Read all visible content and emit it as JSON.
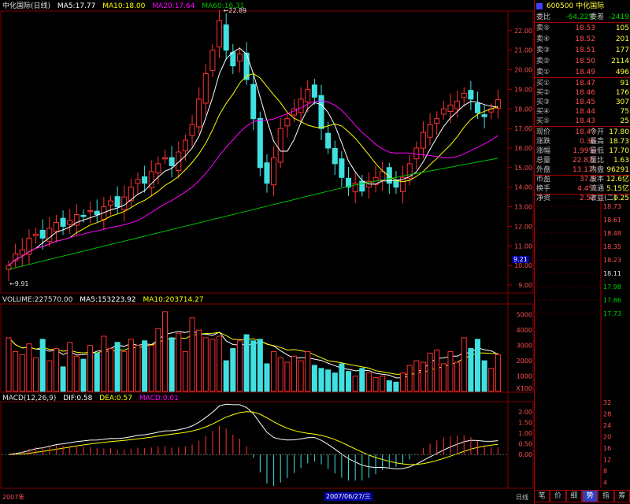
{
  "header": {
    "name": "中化国际(日线)",
    "ma5": "MA5:17.77",
    "ma10": "MA10:18.00",
    "ma20": "MA20:17.64",
    "ma60": "MA60:16.31"
  },
  "volume_header": {
    "label": "VOLUME:227570.00",
    "ma5": "MA5:153223.92",
    "ma10": "MA10:203714.27"
  },
  "macd_header": {
    "label": "MACD(12,26,9)",
    "dif": "DIF:0.58",
    "dea": "DEA:0.57",
    "macd": "MACD:0.01"
  },
  "bottom_axis": {
    "left": "2007年",
    "center": "2007/06/27/三",
    "right": "日线"
  },
  "marker_9": "9.21",
  "colors": {
    "up": "#ff3030",
    "down": "#40e0e0",
    "ma5": "#ffffff",
    "ma10": "#ffff00",
    "ma20": "#ff00ff",
    "ma60": "#00c000",
    "grid": "#800000"
  },
  "chart_data": [
    {
      "type": "candlestick",
      "title": "中化国际(日线)",
      "ylim": [
        9,
        23
      ],
      "yticks": [
        "22.00",
        "21.00",
        "20.00",
        "19.00",
        "18.00",
        "17.00",
        "16.00",
        "15.00",
        "14.00",
        "13.00",
        "12.00",
        "11.00",
        "10.00",
        "9.00"
      ],
      "annotations": [
        {
          "text": "22.89",
          "label": "high"
        },
        {
          "text": "9.91",
          "label": "low"
        }
      ],
      "close_approx": [
        10.0,
        10.6,
        10.8,
        11.4,
        11.6,
        11.4,
        11.9,
        12.2,
        12.0,
        12.3,
        12.6,
        12.5,
        12.8,
        12.6,
        13.0,
        13.3,
        13.0,
        13.5,
        14.0,
        14.4,
        14.2,
        14.8,
        15.2,
        15.5,
        15.1,
        15.8,
        16.4,
        17.2,
        18.5,
        19.8,
        21.0,
        22.5,
        21.0,
        20.2,
        20.8,
        19.5,
        17.5,
        15.0,
        14.2,
        15.5,
        17.0,
        17.5,
        18.0,
        18.5,
        19.0,
        18.6,
        17.0,
        16.0,
        15.2,
        14.5,
        14.0,
        14.2,
        13.8,
        14.3,
        14.5,
        14.8,
        14.2,
        14.0,
        14.5,
        15.2,
        16.0,
        16.8,
        17.2,
        17.5,
        18.0,
        18.2,
        18.4,
        18.8,
        18.5,
        17.8,
        17.6,
        18.0,
        18.47
      ],
      "ma_series": [
        "MA5",
        "MA10",
        "MA20",
        "MA60"
      ]
    },
    {
      "type": "bar",
      "title": "VOLUME",
      "ylim": [
        0,
        5500
      ],
      "yticks": [
        "5000",
        "4000",
        "3000",
        "2000",
        "1000",
        "X100"
      ],
      "values_approx": [
        3500,
        2600,
        2400,
        3100,
        2200,
        3400,
        2000,
        2800,
        1600,
        3200,
        2300,
        2100,
        3000,
        2500,
        3600,
        2800,
        3200,
        2600,
        3400,
        3000,
        3300,
        3000,
        4100,
        5200,
        3500,
        3800,
        2600,
        4800,
        4000,
        3500,
        3400,
        3600,
        2000,
        2800,
        3300,
        3700,
        3300,
        3400,
        1800,
        2600,
        2200,
        1900,
        2300,
        2000,
        2600,
        1700,
        1500,
        1400,
        1200,
        1800,
        1300,
        1000,
        1500,
        1200,
        900,
        1000,
        700,
        600,
        1200,
        1700,
        2000,
        1900,
        2500,
        2700,
        1800,
        2600,
        1900,
        3500,
        2800,
        3400,
        2000,
        1500,
        2400
      ]
    },
    {
      "type": "bar",
      "title": "MACD(12,26,9)",
      "ylim": [
        -1.5,
        2.4
      ],
      "yticks": [
        "2.00",
        "1.50",
        "1.00",
        "0.50",
        "0.00"
      ],
      "series_names": [
        "DIF",
        "DEA",
        "MACD"
      ]
    }
  ],
  "quote": {
    "code": "600500",
    "name": "中化国际",
    "wei_bi_label": "委比",
    "wei_bi": "-64.22%",
    "wei_cha_label": "委差",
    "wei_cha": "-2419",
    "sells": [
      {
        "label": "卖⑤",
        "price": "18.53",
        "vol": "105"
      },
      {
        "label": "卖④",
        "price": "18.52",
        "vol": "201"
      },
      {
        "label": "卖③",
        "price": "18.51",
        "vol": "177"
      },
      {
        "label": "卖②",
        "price": "18.50",
        "vol": "2114"
      },
      {
        "label": "卖①",
        "price": "18.49",
        "vol": "496"
      }
    ],
    "buys": [
      {
        "label": "买①",
        "price": "18.47",
        "vol": "91"
      },
      {
        "label": "买②",
        "price": "18.46",
        "vol": "176"
      },
      {
        "label": "买③",
        "price": "18.45",
        "vol": "307"
      },
      {
        "label": "买④",
        "price": "18.44",
        "vol": "75"
      },
      {
        "label": "买⑤",
        "price": "18.43",
        "vol": "25"
      }
    ],
    "stats": [
      {
        "l1": "现价",
        "v1": "18.47",
        "l2": "今开",
        "v2": "17.80"
      },
      {
        "l1": "涨跌",
        "v1": "0.36",
        "l2": "最高",
        "v2": "18.73"
      },
      {
        "l1": "涨幅",
        "v1": "1.99%",
        "l2": "最低",
        "v2": "17.70"
      },
      {
        "l1": "总量",
        "v1": "22.8万",
        "l2": "量比",
        "v2": "1.63"
      },
      {
        "l1": "外盘",
        "v1": "13.1万",
        "l2": "内盘",
        "v2": "96291"
      },
      {
        "l1": "市盈",
        "v1": "37.3",
        "l2": "股本",
        "v2": "12.6亿"
      },
      {
        "l1": "换手",
        "v1": "4.4%",
        "l2": "流通",
        "v2": "5.15亿"
      },
      {
        "l1": "净资",
        "v1": "2.52",
        "l2": "收益(二)",
        "v2": "0.25"
      }
    ],
    "intraday_ticks": [
      "18.73",
      "18.61",
      "18.48",
      "18.35",
      "18.23",
      "18.11",
      "17.98",
      "17.86",
      "17.73"
    ],
    "intraday_vol_ticks": [
      "32",
      "28",
      "24",
      "20",
      "16",
      "12",
      "8",
      "4"
    ],
    "tabs": [
      "笔",
      "价",
      "细",
      "势",
      "指",
      "筹"
    ]
  }
}
